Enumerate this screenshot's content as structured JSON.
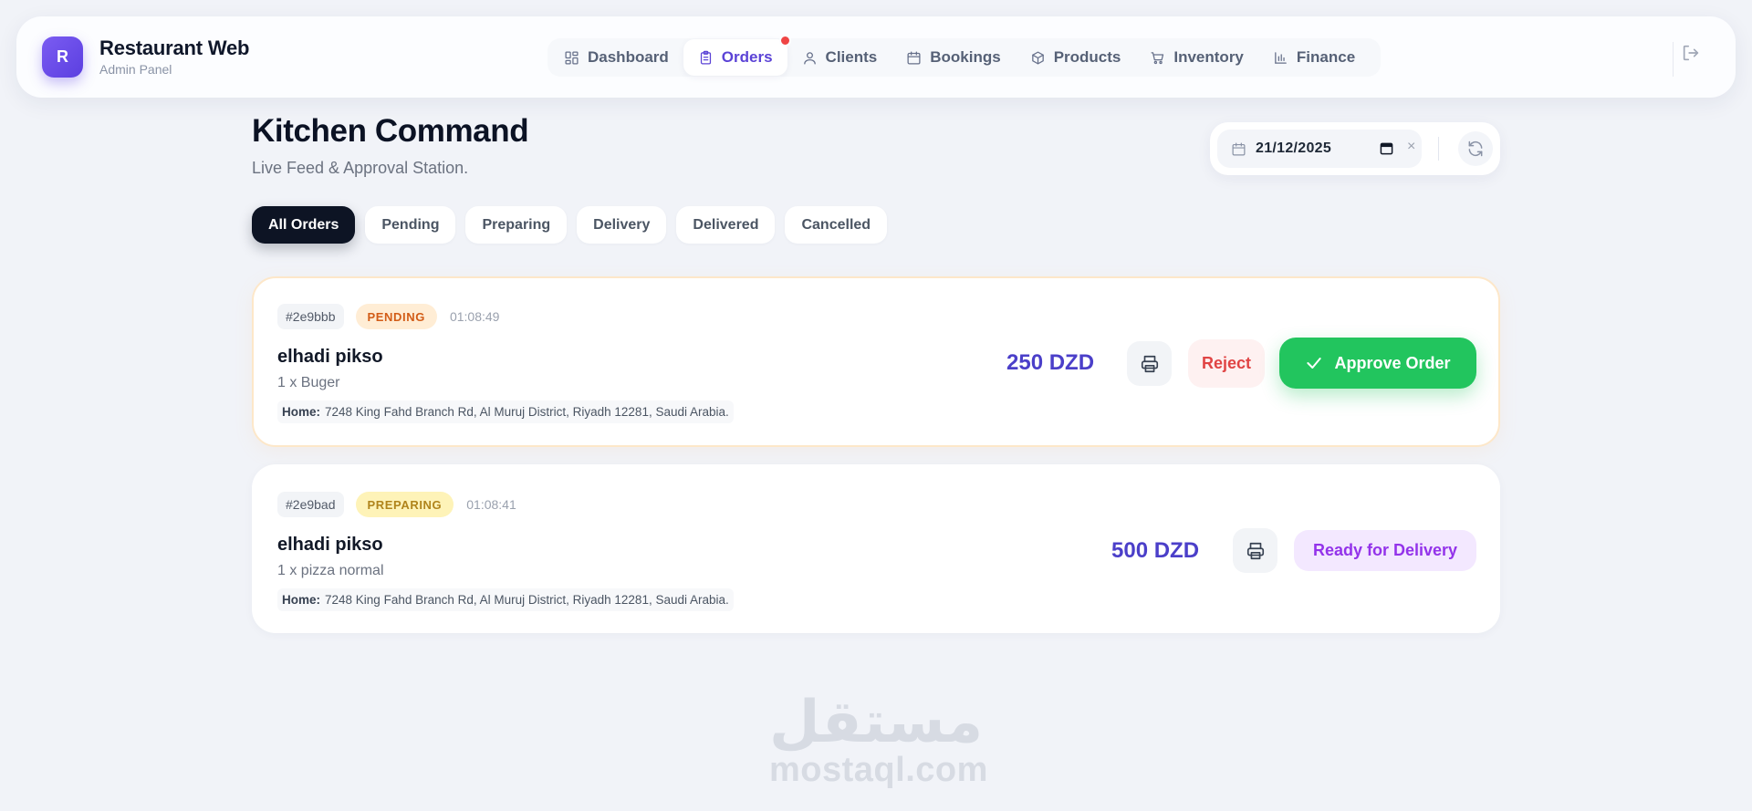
{
  "brand": {
    "logo_letter": "R",
    "title": "Restaurant Web",
    "subtitle": "Admin Panel"
  },
  "nav": {
    "items": [
      {
        "label": "Dashboard",
        "icon": "dashboard-icon"
      },
      {
        "label": "Orders",
        "icon": "clipboard-icon",
        "active": true,
        "has_notification": true
      },
      {
        "label": "Clients",
        "icon": "user-icon"
      },
      {
        "label": "Bookings",
        "icon": "calendar-icon"
      },
      {
        "label": "Products",
        "icon": "box-icon"
      },
      {
        "label": "Inventory",
        "icon": "cart-icon"
      },
      {
        "label": "Finance",
        "icon": "bar-chart-icon"
      }
    ],
    "logout_icon": "logout-icon"
  },
  "header": {
    "title": "Kitchen Command",
    "subtitle": "Live Feed & Approval Station."
  },
  "date_filter": {
    "value": "21/12/2025",
    "clear_label": "×"
  },
  "filters": {
    "tabs": [
      "All Orders",
      "Pending",
      "Preparing",
      "Delivery",
      "Delivered",
      "Cancelled"
    ],
    "active": "All Orders"
  },
  "orders": [
    {
      "id": "#2e9bbb",
      "status": "PENDING",
      "time": "01:08:49",
      "customer": "elhadi pikso",
      "items": "1 x Buger",
      "address_label": "Home:",
      "address": "7248 King Fahd Branch Rd, Al Muruj District, Riyadh 12281, Saudi Arabia.",
      "price": "250 DZD",
      "reject_label": "Reject",
      "approve_label": "Approve Order"
    },
    {
      "id": "#2e9bad",
      "status": "PREPARING",
      "time": "01:08:41",
      "customer": "elhadi pikso",
      "items": "1 x pizza normal",
      "address_label": "Home:",
      "address": "7248 King Fahd Branch Rd, Al Muruj District, Riyadh 12281, Saudi Arabia.",
      "price": "500 DZD",
      "ready_label": "Ready for Delivery"
    }
  ],
  "watermark": {
    "arabic": "مستقل",
    "latin": "mostaql.com"
  },
  "colors": {
    "accent": "#5b43d6",
    "approve": "#22c55e",
    "reject": "#e04444",
    "ready": "#9333ea",
    "price": "#4b3fc9",
    "notification": "#ef4444"
  }
}
